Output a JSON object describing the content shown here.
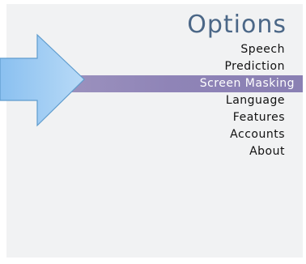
{
  "panel": {
    "title": "Options",
    "items": [
      {
        "label": "Speech",
        "selected": false
      },
      {
        "label": "Prediction",
        "selected": false
      },
      {
        "label": "Screen Masking",
        "selected": true
      },
      {
        "label": "Language",
        "selected": false
      },
      {
        "label": "Features",
        "selected": false
      },
      {
        "label": "Accounts",
        "selected": false
      },
      {
        "label": "About",
        "selected": false
      }
    ]
  },
  "colors": {
    "title": "#4b6787",
    "selected_bg": "#8f84b7",
    "panel_bg": "#f1f2f3",
    "arrow_fill": "#8fc3f1"
  },
  "pointer": {
    "icon": "arrow-pointer-icon"
  }
}
